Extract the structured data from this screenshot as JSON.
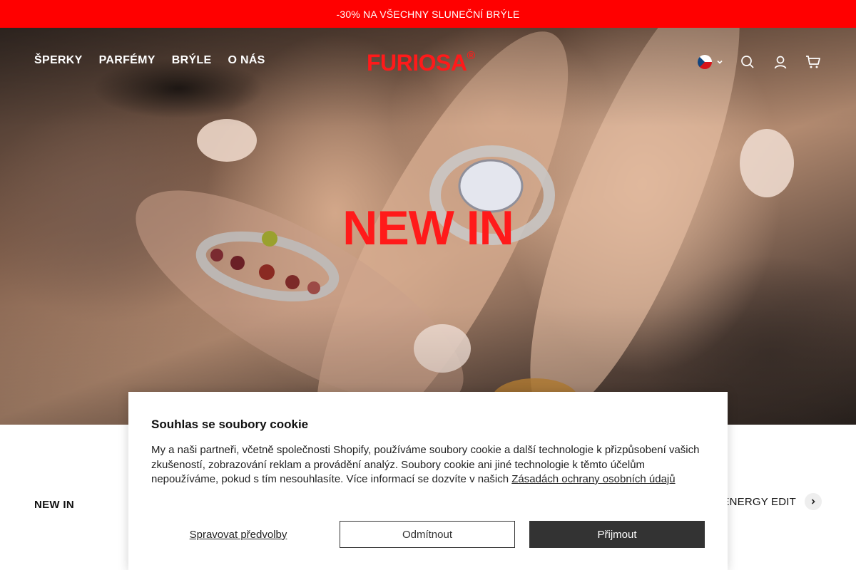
{
  "announcement": {
    "text": "-30% NA VŠECHNY SLUNEČNÍ BRÝLE"
  },
  "header": {
    "nav": [
      {
        "label": "ŠPERKY"
      },
      {
        "label": "PARFÉMY"
      },
      {
        "label": "BRÝLE"
      },
      {
        "label": "O NÁS"
      }
    ],
    "logo": {
      "text": "FURIOSA",
      "mark": "®"
    },
    "icons": {
      "country": "czech-flag-icon",
      "search": "search-icon",
      "account": "account-icon",
      "cart": "cart-icon"
    }
  },
  "hero": {
    "title": "NEW IN"
  },
  "section": {
    "label": "NEW IN",
    "collection_link": "ENERGY EDIT"
  },
  "cookie": {
    "title": "Souhlas se soubory cookie",
    "text": "My a naši partneři, včetně společnosti Shopify, používáme soubory cookie a další technologie k přizpůsobení vašich zkušeností, zobrazování reklam a provádění analýz. Soubory cookie ani jiné technologie k těmto účelům nepoužíváme, pokud s tím nesouhlasíte. Více informací se dozvíte v našich ",
    "link": "Zásadách ochrany osobních údajů",
    "buttons": {
      "manage": "Spravovat předvolby",
      "decline": "Odmítnout",
      "accept": "Přijmout"
    }
  },
  "colors": {
    "brand_red": "#ff0000",
    "accept_button": "#333333"
  }
}
